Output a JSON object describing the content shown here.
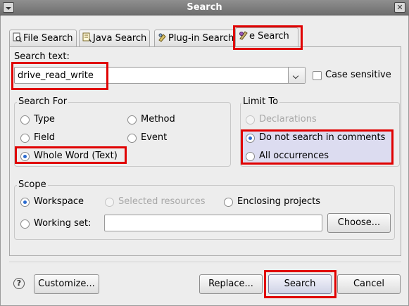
{
  "window": {
    "title": "Search"
  },
  "tabs": [
    {
      "label": "File Search"
    },
    {
      "label": "Java Search"
    },
    {
      "label": "Plug-in Search"
    },
    {
      "label": "e Search"
    }
  ],
  "search_text": {
    "label": "Search text:",
    "value": "drive_read_write",
    "case_sensitive_label": "Case sensitive"
  },
  "search_for": {
    "title": "Search For",
    "options": [
      "Type",
      "Method",
      "Field",
      "Event",
      "Whole Word (Text)"
    ],
    "selected": "Whole Word (Text)"
  },
  "limit_to": {
    "title": "Limit To",
    "options": [
      "Declarations",
      "Do not search in comments",
      "All occurrences"
    ],
    "selected": "Do not search in comments"
  },
  "scope": {
    "title": "Scope",
    "workspace": "Workspace",
    "selected_resources": "Selected resources",
    "enclosing_projects": "Enclosing projects",
    "working_set": "Working set:",
    "working_set_value": "",
    "choose_button": "Choose...",
    "selected": "Workspace"
  },
  "buttons": {
    "customize": "Customize...",
    "replace": "Replace...",
    "search": "Search",
    "cancel": "Cancel"
  },
  "icons": {
    "help": "help-icon",
    "tab_icons": [
      "file-search-icon",
      "java-search-icon",
      "plugin-search-icon",
      "e-search-icon"
    ]
  },
  "colors": {
    "highlight_box": "#e00000",
    "radio_selected": "#2a6acf"
  }
}
